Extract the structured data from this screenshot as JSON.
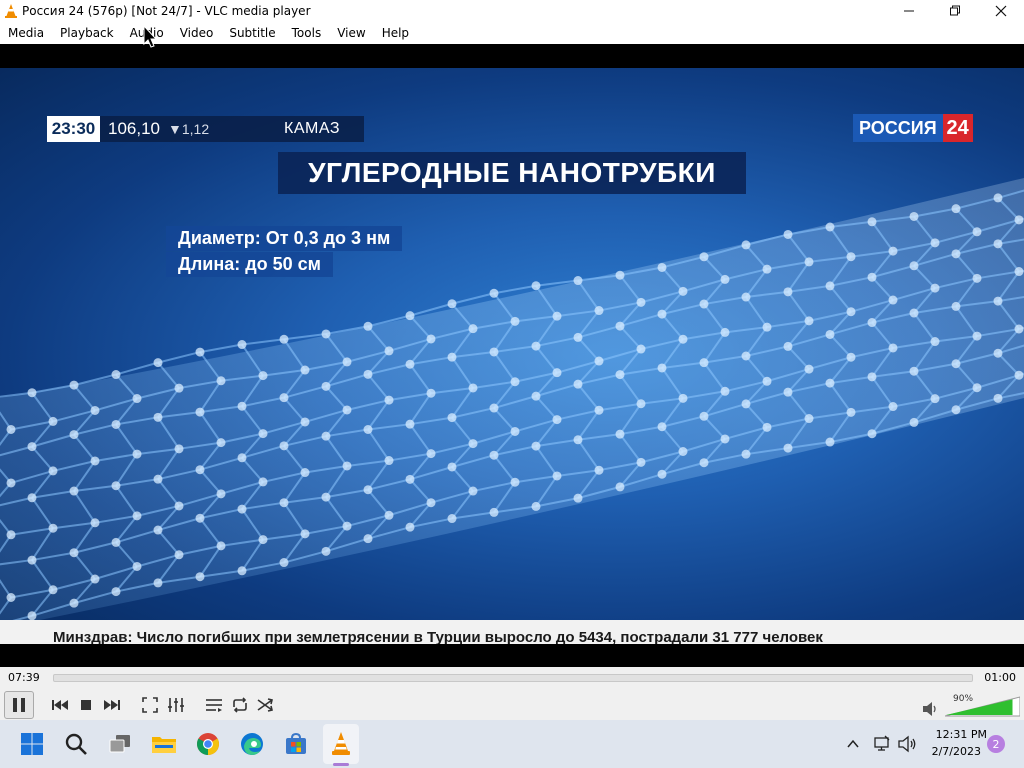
{
  "window": {
    "title": "Россия 24 (576p) [Not 24/7] - VLC media player",
    "controls": {
      "minimize": "—",
      "maximize": "❐",
      "close": "✕"
    }
  },
  "menu": {
    "items": [
      "Media",
      "Playback",
      "Audio",
      "Video",
      "Subtitle",
      "Tools",
      "View",
      "Help"
    ]
  },
  "video": {
    "clock": "23:30",
    "ticker_value": "106,10",
    "ticker_change": "▼1,12",
    "ticker_name": "КАМАЗ",
    "channel_logo_word": "РОССИЯ",
    "channel_logo_num": "24",
    "headline": "УГЛЕРОДНЫЕ НАНОТРУБКИ",
    "info_line1": "Диаметр: От 0,3 до 3 нм",
    "info_line2": "Длина: до 50 см",
    "crawl": "Минздрав: Число погибших при землетрясении в Турции выросло до 5434, пострадали 31 777 человек"
  },
  "playback": {
    "elapsed": "07:39",
    "total": "01:00",
    "progress": 0.0,
    "volume_label": "90%",
    "volume": 0.9
  },
  "taskbar": {
    "time": "12:31 PM",
    "date": "2/7/2023",
    "notifications": "2"
  },
  "colors": {
    "vlc_orange": "#f08c00",
    "accent_blue": "#3d8fe0",
    "volume_green": "#2fbf2f",
    "logo_red": "#d9262b",
    "logo_blue": "#1b59b5"
  }
}
